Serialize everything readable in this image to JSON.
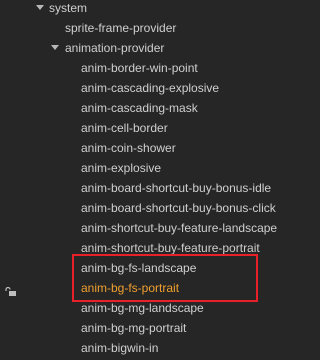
{
  "tree": {
    "rows": [
      {
        "label": "system",
        "level": 0,
        "expanded": true
      },
      {
        "label": "sprite-frame-provider",
        "level": 1
      },
      {
        "label": "animation-provider",
        "level": 1,
        "expanded": true
      },
      {
        "label": "anim-border-win-point",
        "level": 2
      },
      {
        "label": "anim-cascading-explosive",
        "level": 2
      },
      {
        "label": "anim-cascading-mask",
        "level": 2
      },
      {
        "label": "anim-cell-border",
        "level": 2
      },
      {
        "label": "anim-coin-shower",
        "level": 2
      },
      {
        "label": "anim-explosive",
        "level": 2
      },
      {
        "label": "anim-board-shortcut-buy-bonus-idle",
        "level": 2
      },
      {
        "label": "anim-board-shortcut-buy-bonus-click",
        "level": 2
      },
      {
        "label": "anim-shortcut-buy-feature-landscape",
        "level": 2
      },
      {
        "label": "anim-shortcut-buy-feature-portrait",
        "level": 2
      },
      {
        "label": "anim-bg-fs-landscape",
        "level": 2
      },
      {
        "label": "anim-bg-fs-portrait",
        "level": 2,
        "selected": true,
        "locked": true
      },
      {
        "label": "anim-bg-mg-landscape",
        "level": 2
      },
      {
        "label": "anim-bg-mg-portrait",
        "level": 2
      },
      {
        "label": "anim-bigwin-in",
        "level": 2
      }
    ]
  },
  "colors": {
    "background": "#262626",
    "text": "#cfcfcf",
    "selected_text": "#f0a030",
    "annotation_box": "#e8202a"
  },
  "icons": {
    "expand": "triangle-down-icon",
    "lock": "lock-icon"
  }
}
